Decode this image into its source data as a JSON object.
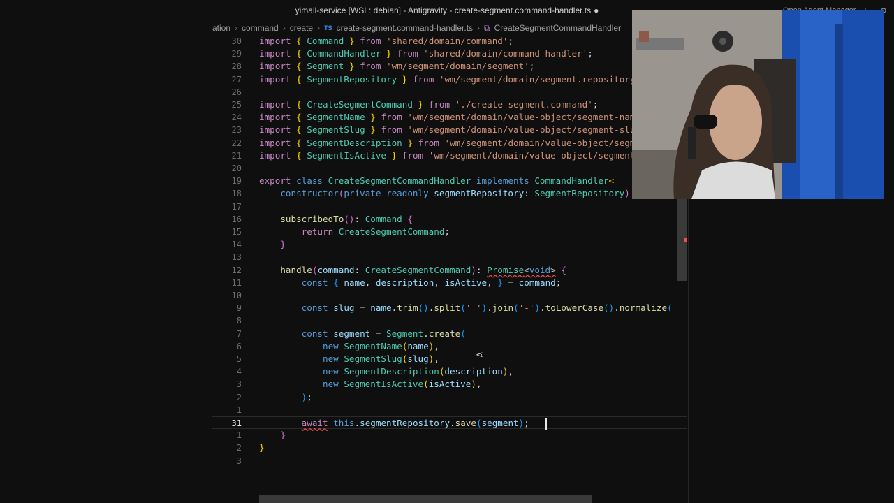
{
  "window": {
    "title": "yimall-service [WSL: debian] - Antigravity - create-segment.command-handler.ts",
    "modified_dot": "●",
    "right_label": "Open Agent Manager"
  },
  "breadcrumb": {
    "items": [
      "ation",
      "command",
      "create"
    ],
    "file_badge": "TS",
    "file": "create-segment.command-handler.ts",
    "symbol": "CreateSegmentCommandHandler"
  },
  "editor": {
    "current_line": "31",
    "lines": [
      {
        "n": "30",
        "html": "<span class=\"kw\">import</span> <span class=\"pb\">{</span> <span class=\"ty\">Command</span> <span class=\"pb\">}</span> <span class=\"kw\">from</span> <span class=\"str\">'shared/domain/command'</span>;"
      },
      {
        "n": "29",
        "html": "<span class=\"kw\">import</span> <span class=\"pb\">{</span> <span class=\"ty\">CommandHandler</span> <span class=\"pb\">}</span> <span class=\"kw\">from</span> <span class=\"str\">'shared/domain/command-handler'</span>;"
      },
      {
        "n": "28",
        "html": "<span class=\"kw\">import</span> <span class=\"pb\">{</span> <span class=\"ty\">Segment</span> <span class=\"pb\">}</span> <span class=\"kw\">from</span> <span class=\"str\">'wm/segment/domain/segment'</span>;"
      },
      {
        "n": "27",
        "html": "<span class=\"kw\">import</span> <span class=\"pb\">{</span> <span class=\"ty\">SegmentRepository</span> <span class=\"pb\">}</span> <span class=\"kw\">from</span> <span class=\"str\">'wm/segment/domain/segment.repository'</span>;"
      },
      {
        "n": "26",
        "html": ""
      },
      {
        "n": "25",
        "html": "<span class=\"kw\">import</span> <span class=\"pb\">{</span> <span class=\"ty\">CreateSegmentCommand</span> <span class=\"pb\">}</span> <span class=\"kw\">from</span> <span class=\"str\">'./create-segment.command'</span>;"
      },
      {
        "n": "24",
        "html": "<span class=\"kw\">import</span> <span class=\"pb\">{</span> <span class=\"ty\">SegmentName</span> <span class=\"pb\">}</span> <span class=\"kw\">from</span> <span class=\"str\">'wm/segment/domain/value-object/segment-name'</span>;"
      },
      {
        "n": "23",
        "html": "<span class=\"kw\">import</span> <span class=\"pb\">{</span> <span class=\"ty\">SegmentSlug</span> <span class=\"pb\">}</span> <span class=\"kw\">from</span> <span class=\"str\">'wm/segment/domain/value-object/segment-slug'</span>;"
      },
      {
        "n": "22",
        "html": "<span class=\"kw\">import</span> <span class=\"pb\">{</span> <span class=\"ty\">SegmentDescription</span> <span class=\"pb\">}</span> <span class=\"kw\">from</span> <span class=\"str\">'wm/segment/domain/value-object/segment-description'</span>;"
      },
      {
        "n": "21",
        "html": "<span class=\"kw\">import</span> <span class=\"pb\">{</span> <span class=\"ty\">SegmentIsActive</span> <span class=\"pb\">}</span> <span class=\"kw\">from</span> <span class=\"str\">'wm/segment/domain/value-object/segment-is-active'</span>;"
      },
      {
        "n": "20",
        "html": ""
      },
      {
        "n": "19",
        "html": "<span class=\"kw\">export</span> <span class=\"kw2\">class</span> <span class=\"ty\">CreateSegmentCommandHandler</span> <span class=\"kw2\">implements</span> <span class=\"ty\">CommandHandler</span><span class=\"pb\">&lt;</span>"
      },
      {
        "n": "18",
        "html": "    <span class=\"kw2\">constructor</span><span class=\"pp\">(</span><span class=\"kw2\">private</span> <span class=\"kw2\">readonly</span> <span class=\"var\">segmentRepository</span>: <span class=\"ty\">SegmentRepository</span><span class=\"pp\">)</span>"
      },
      {
        "n": "17",
        "html": ""
      },
      {
        "n": "16",
        "html": "    <span class=\"fn\">subscribedTo</span><span class=\"pp\">()</span>: <span class=\"ty\">Command</span> <span class=\"pp\">{</span>"
      },
      {
        "n": "15",
        "html": "        <span class=\"kw\">return</span> <span class=\"ty\">CreateSegmentCommand</span>;"
      },
      {
        "n": "14",
        "html": "    <span class=\"pp\">}</span>"
      },
      {
        "n": "13",
        "html": ""
      },
      {
        "n": "12",
        "html": "    <span class=\"fn\">handle</span><span class=\"pp\">(</span><span class=\"var\">command</span>: <span class=\"ty\">CreateSegmentCommand</span><span class=\"pp\">)</span>: <span class=\"ty err\">Promise</span><span class=\"err\">&lt;<span class=\"kw2\">void</span>&gt;</span> <span class=\"pp\">{</span>"
      },
      {
        "n": "11",
        "html": "        <span class=\"kw2\">const</span> <span class=\"pl\">{</span> <span class=\"var\">name</span>, <span class=\"var\">description</span>, <span class=\"var\">isActive</span>, <span class=\"pl\">}</span> = <span class=\"var\">command</span>;"
      },
      {
        "n": "10",
        "html": ""
      },
      {
        "n": "9",
        "html": "        <span class=\"kw2\">const</span> <span class=\"var\">slug</span> = <span class=\"var\">name</span>.<span class=\"fn\">trim</span><span class=\"pl\">()</span>.<span class=\"fn\">split</span><span class=\"pl\">(</span><span class=\"str\">' '</span><span class=\"pl\">)</span>.<span class=\"fn\">join</span><span class=\"pl\">(</span><span class=\"str\">'-'</span><span class=\"pl\">)</span>.<span class=\"fn\">toLowerCase</span><span class=\"pl\">()</span>.<span class=\"fn\">normalize</span><span class=\"pl\">(</span>"
      },
      {
        "n": "8",
        "html": ""
      },
      {
        "n": "7",
        "html": "        <span class=\"kw2\">const</span> <span class=\"var\">segment</span> = <span class=\"ty\">Segment</span>.<span class=\"fn\">create</span><span class=\"pl\">(</span>"
      },
      {
        "n": "6",
        "html": "            <span class=\"kw2\">new</span> <span class=\"ty\">SegmentName</span><span class=\"pb\">(</span><span class=\"var\">name</span><span class=\"pb\">)</span>,"
      },
      {
        "n": "5",
        "html": "            <span class=\"kw2\">new</span> <span class=\"ty\">SegmentSlug</span><span class=\"pb\">(</span><span class=\"var\">slug</span><span class=\"pb\">)</span>,"
      },
      {
        "n": "4",
        "html": "            <span class=\"kw2\">new</span> <span class=\"ty\">SegmentDescription</span><span class=\"pb\">(</span><span class=\"var\">description</span><span class=\"pb\">)</span>,"
      },
      {
        "n": "3",
        "html": "            <span class=\"kw2\">new</span> <span class=\"ty\">SegmentIsActive</span><span class=\"pb\">(</span><span class=\"var\">isActive</span><span class=\"pb\">)</span>,"
      },
      {
        "n": "2",
        "html": "        <span class=\"pl\">)</span>;"
      },
      {
        "n": "1",
        "html": ""
      },
      {
        "n": "31",
        "html": "        <span class=\"kw err\">await</span> <span class=\"kw2\">this</span>.<span class=\"var\">segmentRepository</span>.<span class=\"fn\">save</span><span class=\"pl\">(</span><span class=\"var\">segment</span><span class=\"pl\">)</span>;"
      },
      {
        "n": "1",
        "html": "    <span class=\"pp\">}</span>"
      },
      {
        "n": "2",
        "html": "<span class=\"pb\">}</span>"
      },
      {
        "n": "3",
        "html": ""
      }
    ]
  },
  "colors": {
    "background": "#0f0f0f",
    "keyword": "#c586c0",
    "type": "#4ec9b0",
    "string": "#ce9178",
    "error": "#f14c4c"
  }
}
